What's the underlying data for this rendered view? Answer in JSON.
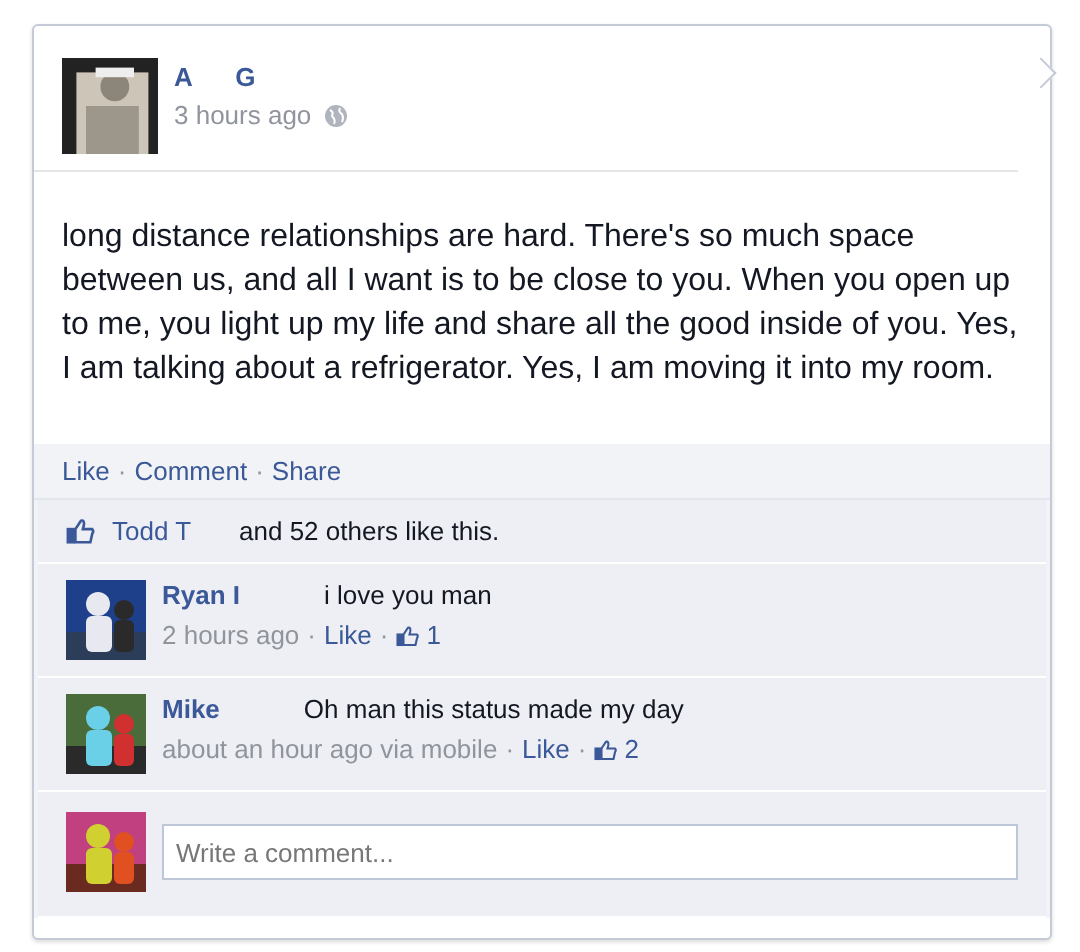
{
  "post": {
    "author": "A      G",
    "time": "3 hours ago",
    "text": "long distance relationships are hard. There's so much space between us, and all I want is to be close to you. When you open up to me, you light up my life and share all the good inside of you. Yes, I am talking about a refrigerator. Yes, I am moving it into my room."
  },
  "separator": "·",
  "actions": [
    "Like",
    "Comment",
    "Share"
  ],
  "likes": {
    "names": "Todd T",
    "rest": "and 52 others like this."
  },
  "comments": [
    {
      "author": "Ryan I",
      "text": "i love you man",
      "time": "2 hours ago",
      "like": "Like",
      "count": "1"
    },
    {
      "author": "Mike",
      "text": "Oh man this status made my day",
      "time": "about an hour ago via mobile",
      "like": "Like",
      "count": "2"
    }
  ],
  "comment_box": {
    "placeholder": "Write a comment..."
  }
}
